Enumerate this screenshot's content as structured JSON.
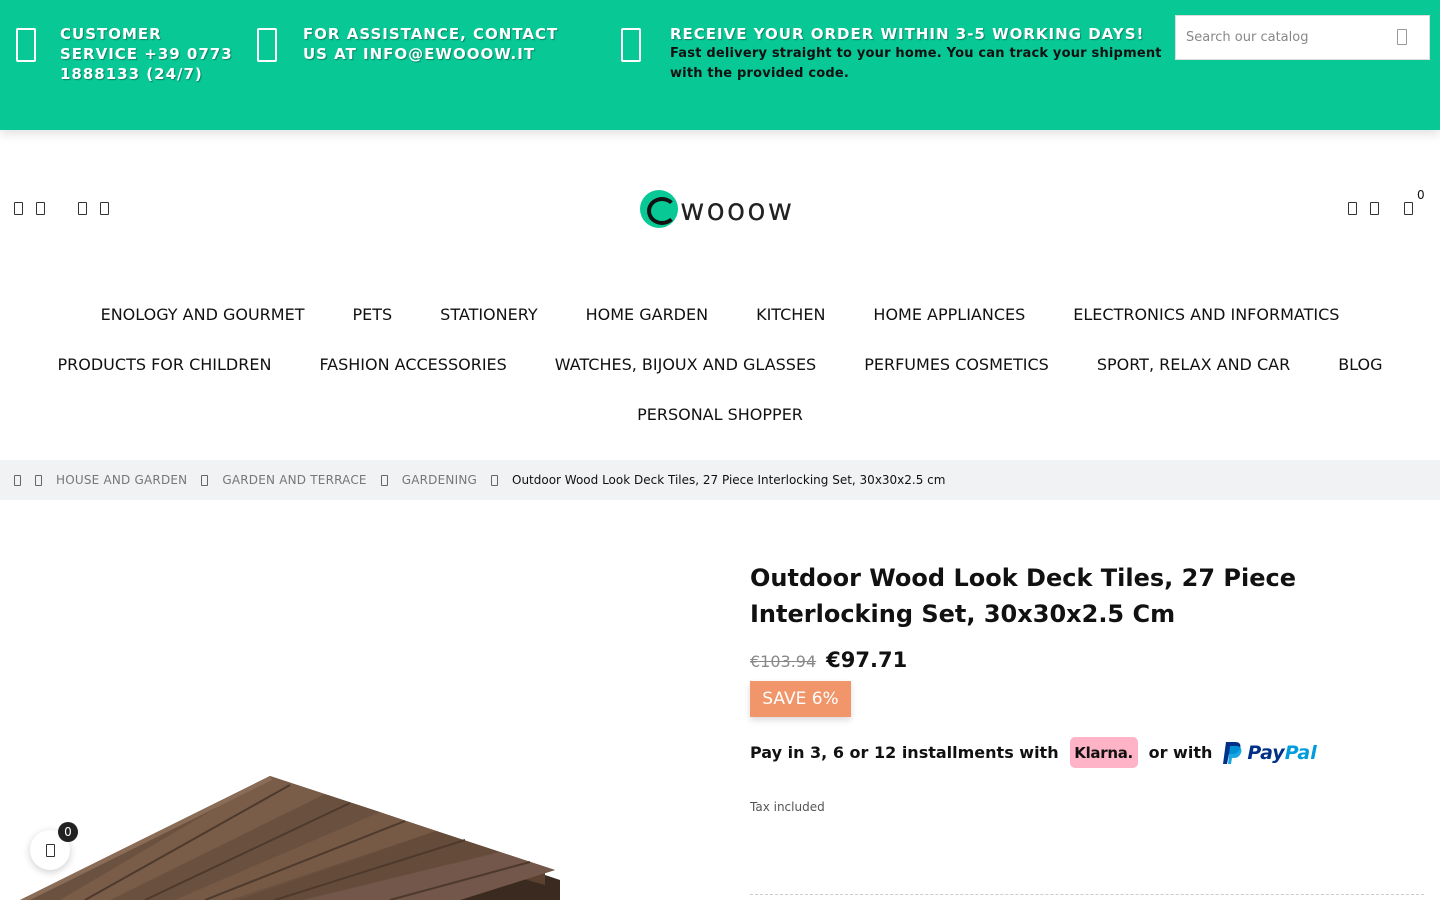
{
  "topbar": {
    "items": [
      {
        "icon": "phone-icon",
        "text": "CUSTOMER SERVICE +39 0773 1888133 (24/7)",
        "sub": ""
      },
      {
        "icon": "mail-icon",
        "text": "FOR ASSISTANCE, CONTACT US AT info@ewooow.it",
        "sub": ""
      },
      {
        "icon": "truck-icon",
        "text": "RECEIVE YOUR ORDER WITHIN 3-5 WORKING DAYS!",
        "sub": "Fast delivery straight to your home. You can track your shipment with the provided code."
      }
    ],
    "bg_color": "#08c896"
  },
  "search": {
    "placeholder": "Search our catalog",
    "icon": "search-icon"
  },
  "header": {
    "logo_text": "wooow",
    "cart_count": "0"
  },
  "menu": {
    "row1": [
      "ENOLOGY AND GOURMET",
      "PETS",
      "STATIONERY",
      "HOME GARDEN",
      "KITCHEN",
      "HOME APPLIANCES",
      "ELECTRONICS AND INFORMATICS"
    ],
    "row2": [
      "PRODUCTS FOR CHILDREN",
      "FASHION ACCESSORIES",
      "WATCHES, BIJOUX AND GLASSES",
      "PERFUMES COSMETICS",
      "SPORT, RELAX AND CAR",
      "BLOG"
    ],
    "row3": [
      "PERSONAL SHOPPER"
    ]
  },
  "breadcrumb": {
    "items": [
      "HOUSE AND GARDEN",
      "GARDEN AND TERRACE",
      "GARDENING"
    ],
    "current": "Outdoor Wood Look Deck Tiles, 27 Piece Interlocking Set, 30x30x2.5 cm"
  },
  "product": {
    "title": "Outdoor Wood Look Deck Tiles, 27 Piece Interlocking Set, 30x30x2.5 Cm",
    "old_price": "€103.94",
    "price": "€97.71",
    "save_label": "SAVE 6%",
    "installments_text": "Pay in 3, 6 or 12 installments with",
    "klarna_label": "Klarna.",
    "or_with": "or with",
    "paypal_label_a": "Pay",
    "paypal_label_b": "Pal",
    "tax_note": "Tax included"
  },
  "wishlist_float": {
    "count": "0",
    "icon": "heart-icon"
  }
}
